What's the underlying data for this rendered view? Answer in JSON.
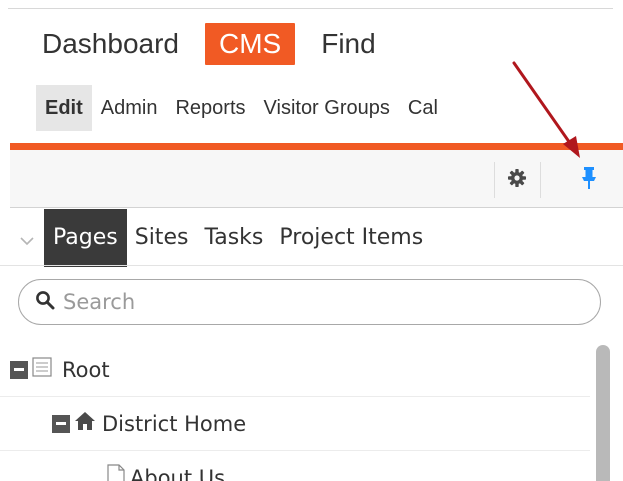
{
  "top_nav": {
    "main": [
      {
        "label": "Dashboard",
        "active": false
      },
      {
        "label": "CMS",
        "active": true
      },
      {
        "label": "Find",
        "active": false
      }
    ],
    "sub": [
      {
        "label": "Edit",
        "active": true
      },
      {
        "label": "Admin",
        "active": false
      },
      {
        "label": "Reports",
        "active": false
      },
      {
        "label": "Visitor Groups",
        "active": false
      },
      {
        "label": "Cal",
        "active": false
      }
    ]
  },
  "toolbar": {
    "icons": [
      "gear-icon",
      "pin-icon"
    ]
  },
  "pane": {
    "tabs": [
      {
        "label": "Pages",
        "active": true
      },
      {
        "label": "Sites",
        "active": false
      },
      {
        "label": "Tasks",
        "active": false
      },
      {
        "label": "Project Items",
        "active": false
      }
    ],
    "search": {
      "placeholder": "Search",
      "value": ""
    }
  },
  "tree": [
    {
      "label": "Root",
      "icon": "root-page-icon",
      "level": 0,
      "expanded": true
    },
    {
      "label": "District Home",
      "icon": "home-icon",
      "level": 1,
      "expanded": true
    },
    {
      "label": "About Us",
      "icon": "page-icon",
      "level": 2,
      "expanded": false
    }
  ],
  "colors": {
    "accent": "#f15a24",
    "pin": "#1e90ff",
    "arrow": "#b0171d",
    "active_tab": "#3a3a3a"
  }
}
